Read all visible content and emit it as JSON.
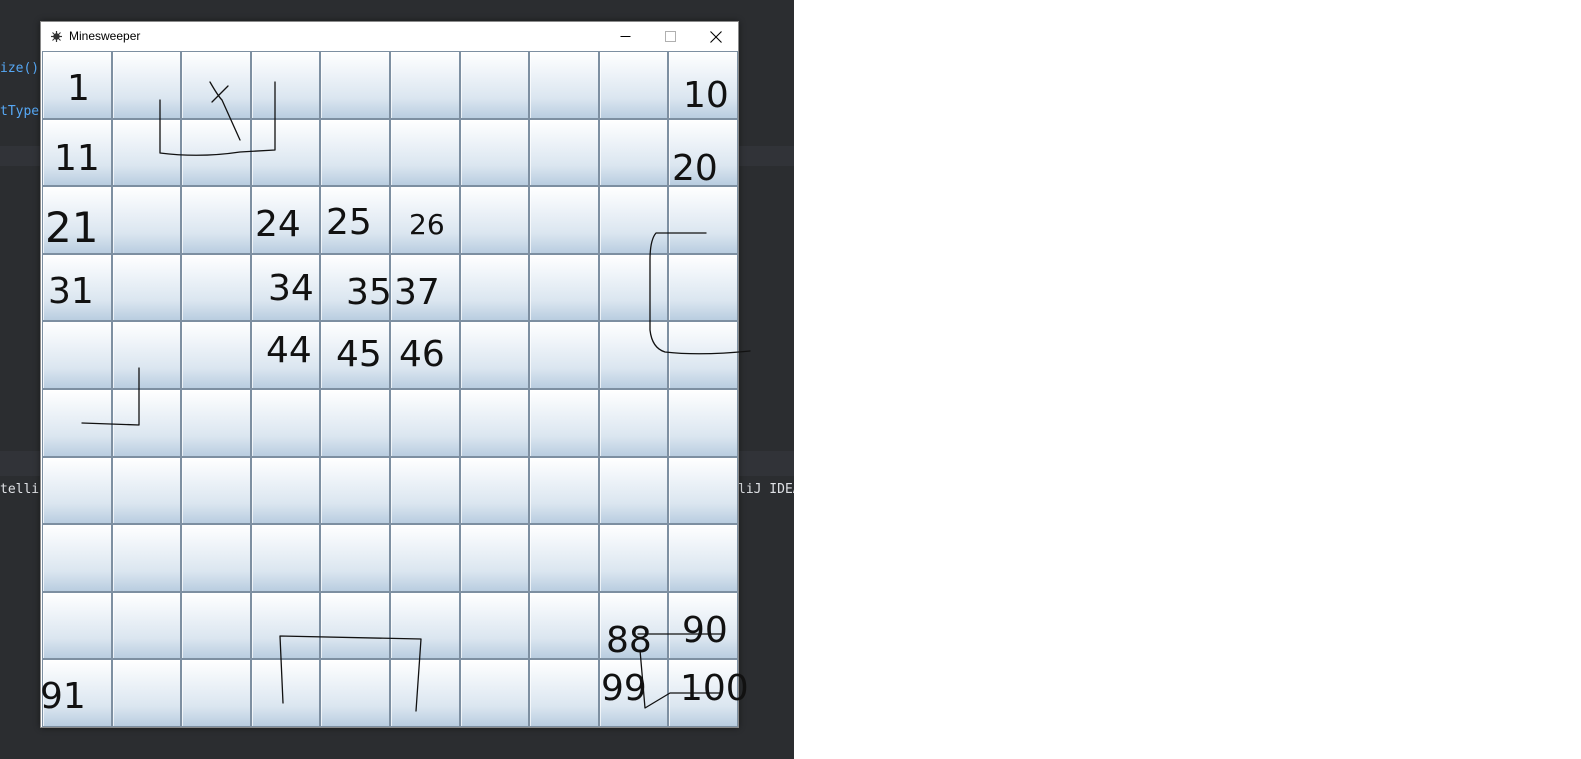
{
  "ide": {
    "code_lines": [
      {
        "text": "ize()"
      },
      {
        "text": "tType"
      },
      {
        "text": "telli"
      },
      {
        "text": "liJ IDEA"
      }
    ]
  },
  "window": {
    "title": "Minesweeper",
    "icon": "mine-icon",
    "controls": [
      "minimize-icon",
      "maximize-icon",
      "close-icon"
    ]
  },
  "board": {
    "rows": 10,
    "cols": 10
  },
  "annotations": [
    "1",
    "10",
    "11",
    "20",
    "21",
    "24",
    "25",
    "26",
    "31",
    "34",
    "35",
    "37",
    "44",
    "45",
    "46",
    "88",
    "90",
    "91",
    "99",
    "100"
  ]
}
